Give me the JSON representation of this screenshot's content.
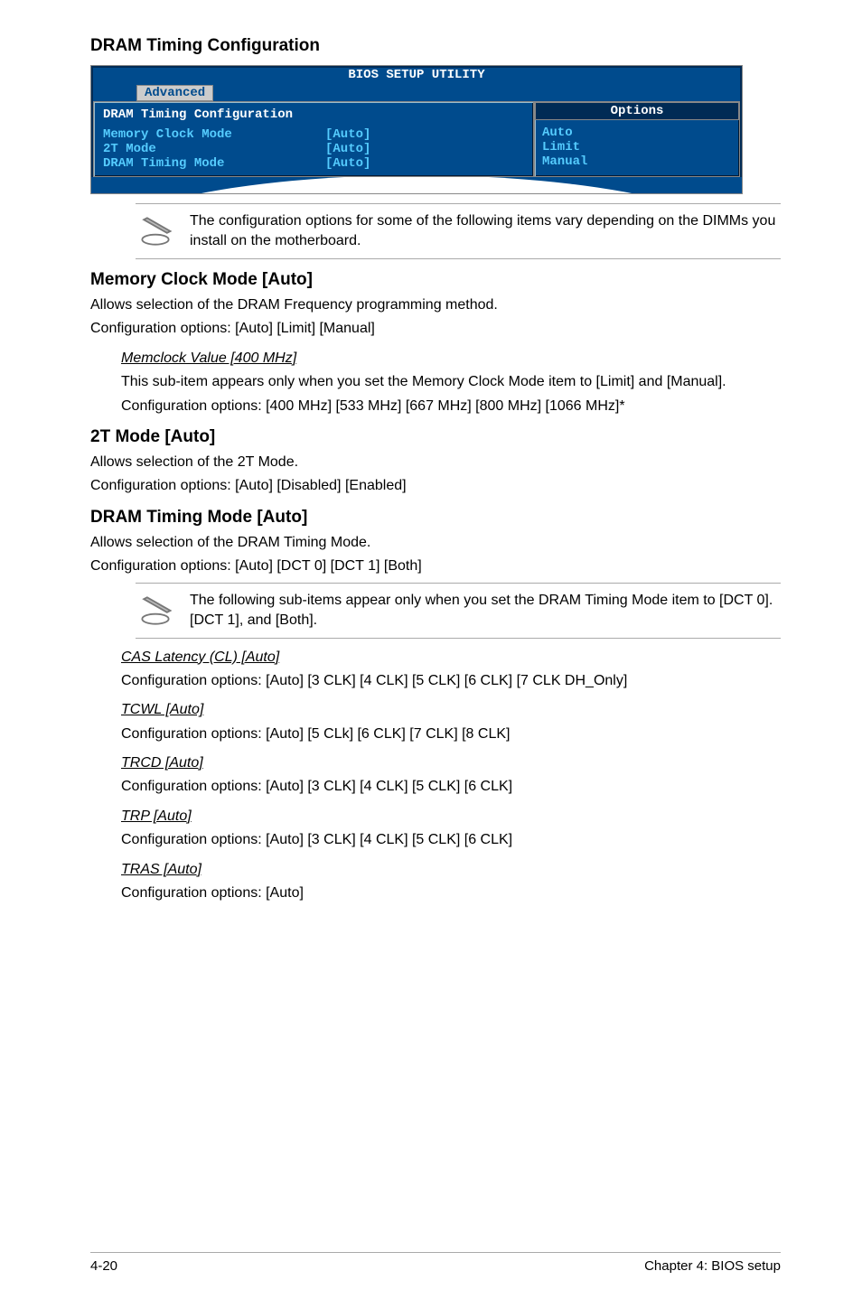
{
  "page_title": "DRAM Timing Configuration",
  "bios": {
    "title": "BIOS SETUP UTILITY",
    "tab": "Advanced",
    "panel_title": "DRAM Timing Configuration",
    "items": [
      {
        "label": "Memory Clock Mode",
        "value": "[Auto]"
      },
      {
        "label": "2T Mode",
        "value": "[Auto]"
      },
      {
        "label": "DRAM Timing Mode",
        "value": "[Auto]"
      }
    ],
    "options_title": "Options",
    "options": [
      "Auto",
      "Limit",
      "Manual"
    ]
  },
  "note1": "The configuration options for some of the following items vary depending on the DIMMs you install on the motherboard.",
  "section_mcm": {
    "heading": "Memory Clock Mode [Auto]",
    "line1": "Allows selection of the DRAM Frequency programming method.",
    "line2": "Configuration options: [Auto] [Limit] [Manual]",
    "sub_title": "Memclock Value [400 MHz]",
    "sub_line1": "This sub-item appears only when you set the Memory Clock Mode item to [Limit] and [Manual].",
    "sub_line2": "Configuration options: [400 MHz] [533 MHz] [667 MHz] [800 MHz] [1066 MHz]*"
  },
  "section_2t": {
    "heading": "2T Mode [Auto]",
    "line1": "Allows selection of the 2T Mode.",
    "line2": "Configuration options: [Auto] [Disabled] [Enabled]"
  },
  "section_dtm": {
    "heading": "DRAM Timing Mode [Auto]",
    "line1": "Allows selection of the DRAM Timing Mode.",
    "line2": "Configuration options: [Auto] [DCT 0] [DCT 1] [Both]"
  },
  "note2": "The following sub-items appear only when you set the DRAM Timing Mode item to [DCT 0]. [DCT 1], and [Both].",
  "sub_items": [
    {
      "title": "CAS Latency (CL) [Auto]",
      "text": "Configuration options: [Auto] [3 CLK] [4 CLK] [5 CLK] [6 CLK] [7 CLK DH_Only]"
    },
    {
      "title": "TCWL [Auto]",
      "text": "Configuration options: [Auto] [5 CLk] [6 CLK] [7 CLK] [8 CLK]"
    },
    {
      "title": "TRCD [Auto]",
      "text": "Configuration options: [Auto] [3 CLK] [4 CLK] [5 CLK] [6 CLK]"
    },
    {
      "title": "TRP [Auto]",
      "text": "Configuration options: [Auto] [3 CLK] [4 CLK] [5 CLK] [6 CLK]"
    },
    {
      "title": "TRAS [Auto]",
      "text": "Configuration options: [Auto]"
    }
  ],
  "footer": {
    "left": "4-20",
    "right": "Chapter 4: BIOS setup"
  }
}
